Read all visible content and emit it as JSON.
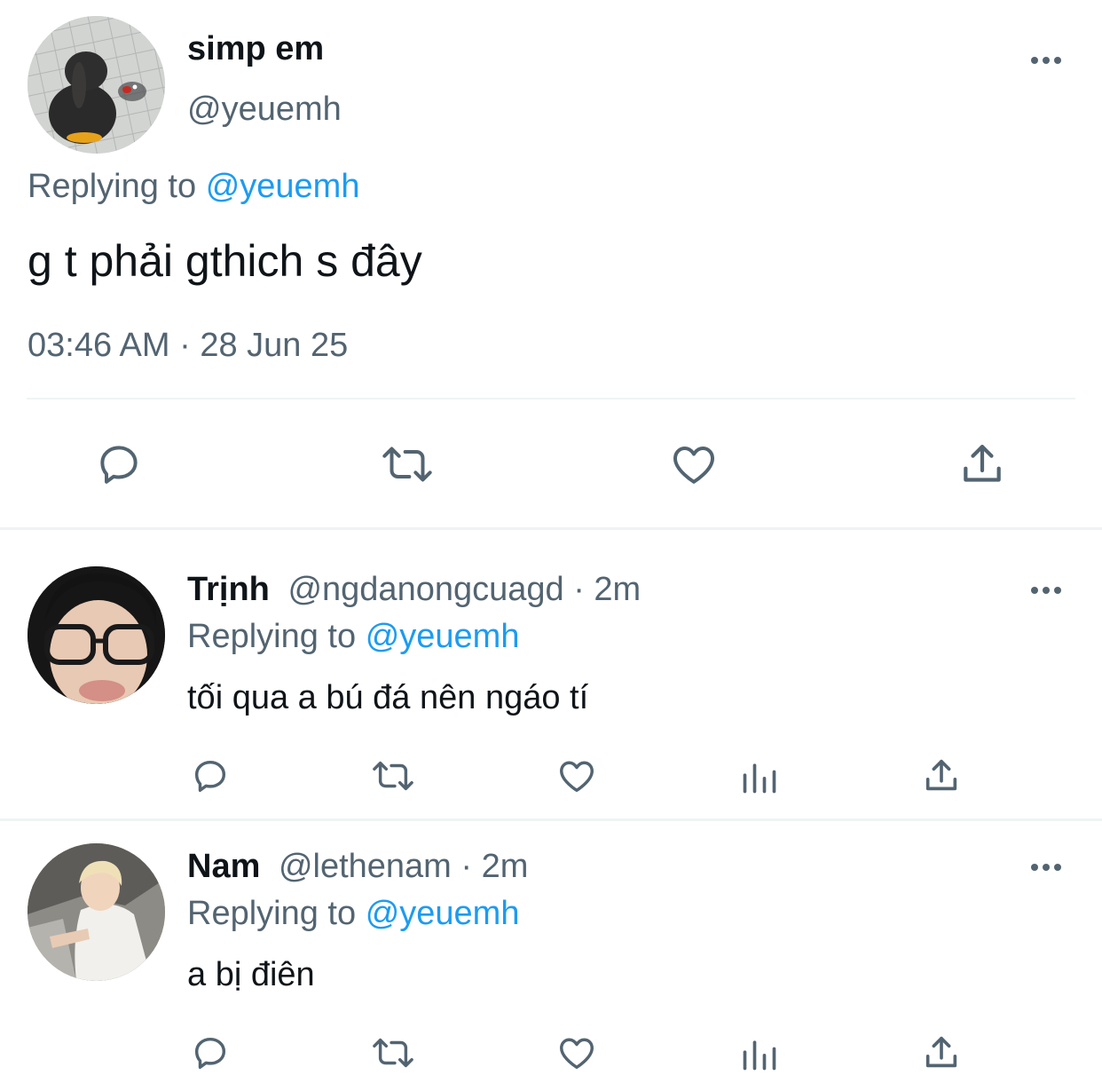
{
  "main_tweet": {
    "display_name": "simp em",
    "handle": "@yeuemh",
    "replying_prefix": "Replying to",
    "replying_to": "@yeuemh",
    "text": "g t phải gthich s đây",
    "timestamp": "03:46 AM · 28 Jun 25",
    "avatar_icon": "stuffed-penguin-avatar",
    "actions": [
      "reply-icon",
      "retweet-icon",
      "like-icon",
      "share-icon"
    ]
  },
  "replies": [
    {
      "display_name": "Trịnh",
      "handle": "@ngdanongcuagd",
      "separator": "·",
      "time": "2m",
      "replying_prefix": "Replying to",
      "replying_to": "@yeuemh",
      "text": "tối qua a bú đá nên ngáo tí",
      "avatar_icon": "person-glasses-avatar",
      "actions": [
        "reply-icon",
        "retweet-icon",
        "like-icon",
        "analytics-icon",
        "share-icon"
      ]
    },
    {
      "display_name": "Nam",
      "handle": "@lethenam",
      "separator": "·",
      "time": "2m",
      "replying_prefix": "Replying to",
      "replying_to": "@yeuemh",
      "text": "a bị điên",
      "avatar_icon": "person-outdoor-avatar",
      "actions": [
        "reply-icon",
        "retweet-icon",
        "like-icon",
        "analytics-icon",
        "share-icon"
      ]
    }
  ],
  "colors": {
    "accent": "#1d9bf0",
    "muted": "#536471",
    "divider": "#eff3f4",
    "text": "#0f1419"
  }
}
